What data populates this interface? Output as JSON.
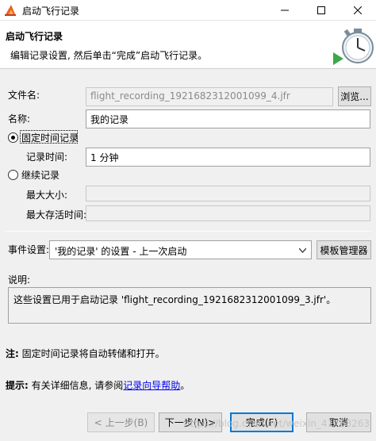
{
  "window": {
    "title": "启动飞行记录"
  },
  "header": {
    "title": "启动飞行记录",
    "description": "编辑记录设置, 然后单击“完成”启动飞行记录。"
  },
  "form": {
    "filename_label": "文件名:",
    "filename_value": "flight_recording_1921682312001099_4.jfr",
    "browse_button": "浏览...",
    "name_label": "名称:",
    "name_value": "我的记录",
    "fixed_radio": "固定时间记录",
    "duration_label": "记录时间:",
    "duration_value": "1 分钟",
    "continuous_radio": "继续记录",
    "max_size_label": "最大大小:",
    "max_age_label": "最大存活时间:",
    "event_label": "事件设置:",
    "event_value": "'我的记录' 的设置 - 上一次启动",
    "template_manager_button": "模板管理器",
    "desc_label": "说明:",
    "desc_value": "这些设置已用于启动记录 'flight_recording_1921682312001099_3.jfr'。"
  },
  "notes": {
    "note_label": "注:",
    "note_text": "固定时间记录将自动转储和打开。",
    "tip_label": "提示:",
    "tip_text": "有关详细信息, 请参阅",
    "tip_link": "记录向导帮助",
    "tip_end": "。"
  },
  "buttons": {
    "back": "< 上一步(B)",
    "next": "下一步(N)>",
    "finish": "完成(F)",
    "cancel": "取消"
  },
  "watermark": "https://blog.csdn.net/weixin_41768263"
}
